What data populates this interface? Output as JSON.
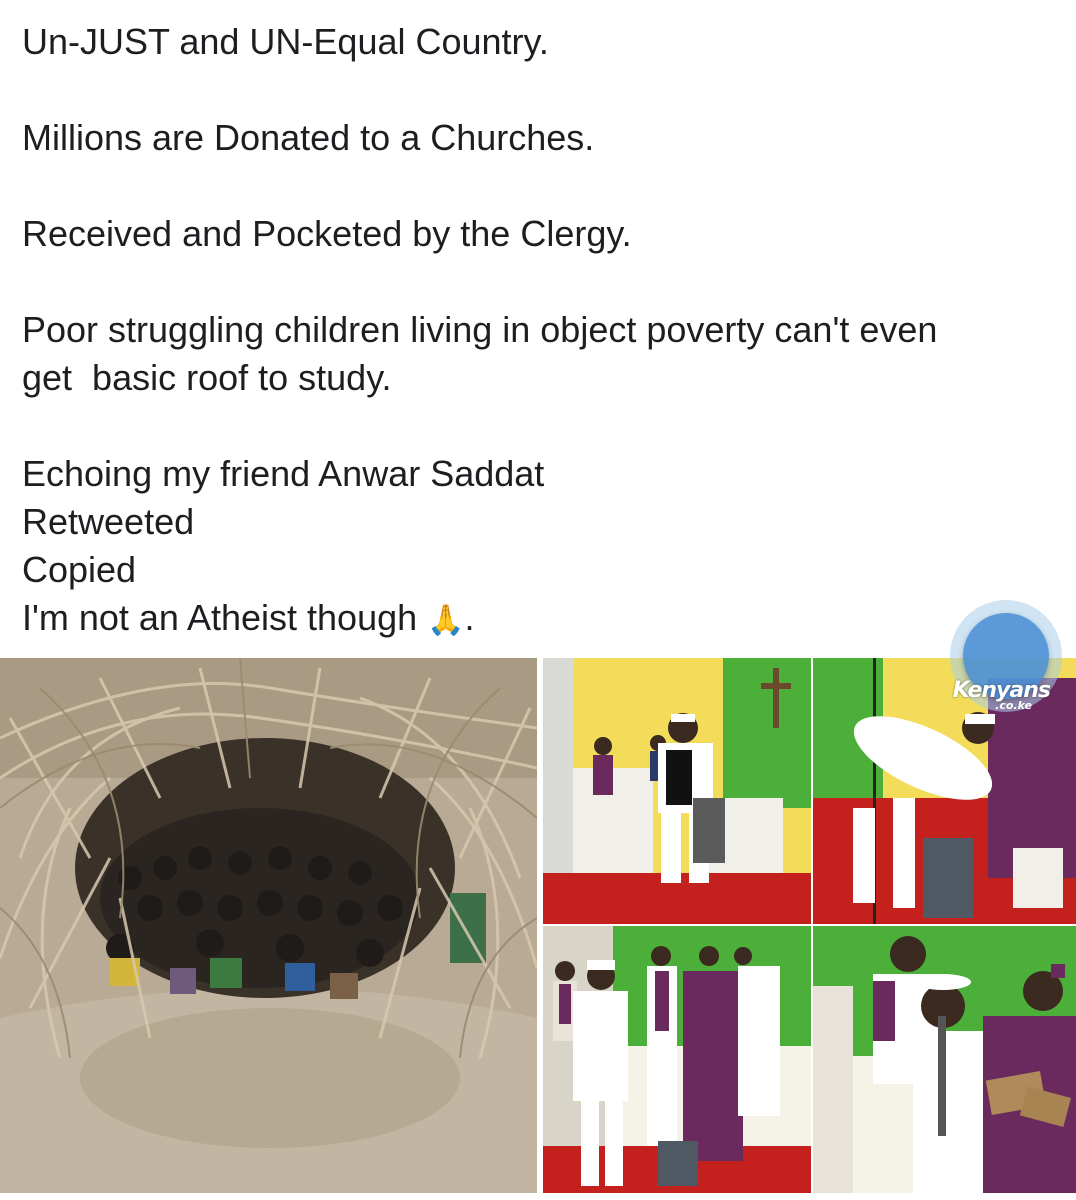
{
  "post": {
    "lines": [
      "Un-JUST and UN-Equal Country.",
      "",
      "Millions are Donated to a Churches.",
      "",
      "Received and Pocketed by the Clergy.",
      "",
      "Poor struggling children living in object poverty can't even",
      "get  basic roof to study.",
      "",
      "Echoing my friend Anwar Saddat",
      "Retweeted",
      "Copied",
      "I'm not an Atheist though"
    ],
    "emoji": "🙏",
    "trailing": "."
  },
  "photos": {
    "left_alt": "children in hut",
    "collage": [
      "church-photo-1",
      "church-photo-2",
      "church-photo-3",
      "church-photo-4"
    ]
  },
  "watermark": {
    "main": "Kenyans",
    "sub": ".co.ke"
  },
  "colors": {
    "text": "#1c1e21",
    "fab": "#468cd2",
    "church_green": "#4caf3a",
    "church_yellow": "#f2dc5a",
    "vestment_purple": "#6b2a5e",
    "carpet_red": "#c4211e"
  }
}
